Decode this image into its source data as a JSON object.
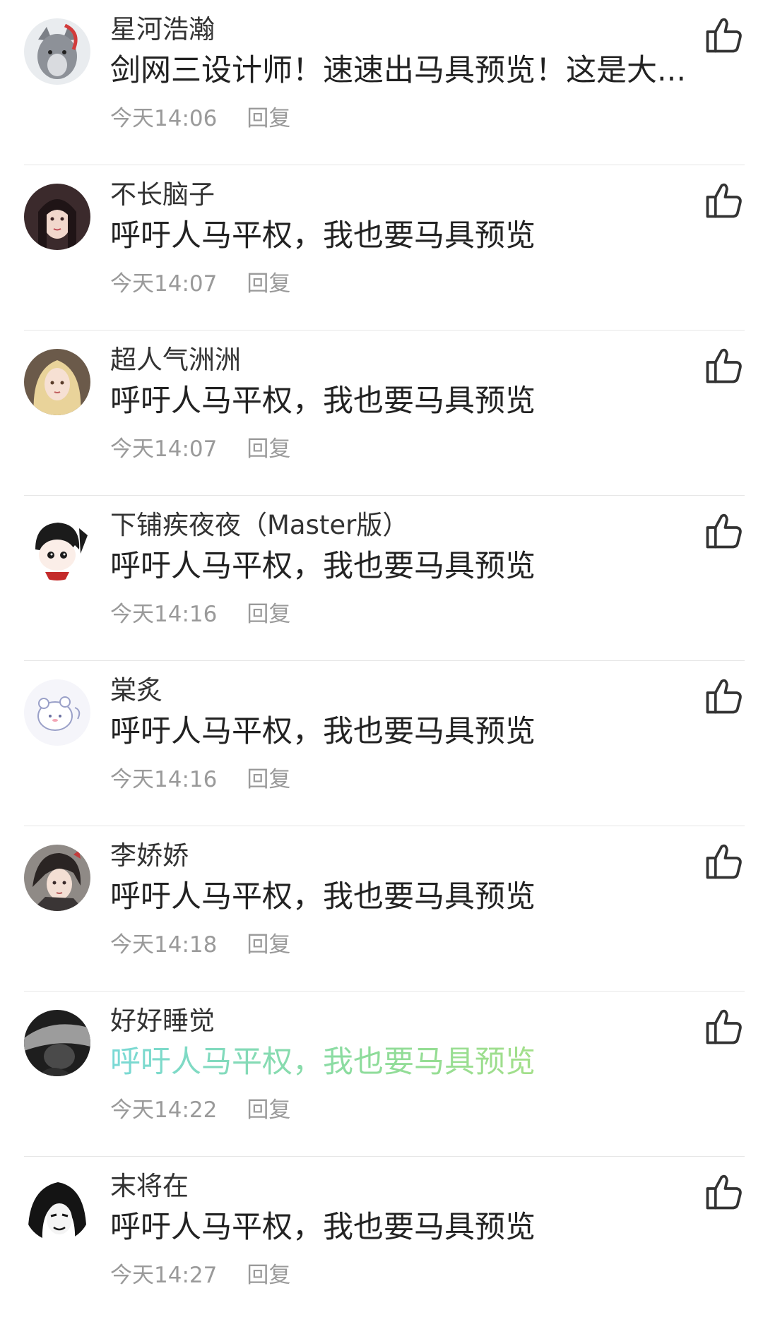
{
  "comments": [
    {
      "username": "星河浩瀚",
      "content": "剑网三设计师！速速出马具预览！这是大...",
      "time": "今天14:06",
      "reply_label": "回复",
      "avatar_icon": "wolf-avatar-icon",
      "highlight": false
    },
    {
      "username": "不长脑子",
      "content": "呼吁人马平权，我也要马具预览",
      "time": "今天14:07",
      "reply_label": "回复",
      "avatar_icon": "girl-avatar-icon",
      "highlight": false
    },
    {
      "username": "超人气洲洲",
      "content": "呼吁人马平权，我也要马具预览",
      "time": "今天14:07",
      "reply_label": "回复",
      "avatar_icon": "blonde-avatar-icon",
      "highlight": false
    },
    {
      "username": "下铺疾夜夜（Master版）",
      "content": "呼吁人马平权，我也要马具预览",
      "time": "今天14:16",
      "reply_label": "回复",
      "avatar_icon": "chibi-avatar-icon",
      "highlight": false
    },
    {
      "username": "棠炙",
      "content": "呼吁人马平权，我也要马具预览",
      "time": "今天14:16",
      "reply_label": "回复",
      "avatar_icon": "sketch-avatar-icon",
      "highlight": false
    },
    {
      "username": "李娇娇",
      "content": "呼吁人马平权，我也要马具预览",
      "time": "今天14:18",
      "reply_label": "回复",
      "avatar_icon": "warrior-avatar-icon",
      "highlight": false
    },
    {
      "username": "好好睡觉",
      "content": "呼吁人马平权，我也要马具预览",
      "time": "今天14:22",
      "reply_label": "回复",
      "avatar_icon": "dark-avatar-icon",
      "highlight": true
    },
    {
      "username": "末将在",
      "content": "呼吁人马平权，我也要马具预览",
      "time": "今天14:27",
      "reply_label": "回复",
      "avatar_icon": "ink-avatar-icon",
      "highlight": false
    }
  ],
  "colors": {
    "meta_text": "#9a9a9a",
    "divider": "#e6e6e6",
    "like_icon": "#333333",
    "highlight_start": "#79d9d6",
    "highlight_end": "#b7e27a"
  }
}
